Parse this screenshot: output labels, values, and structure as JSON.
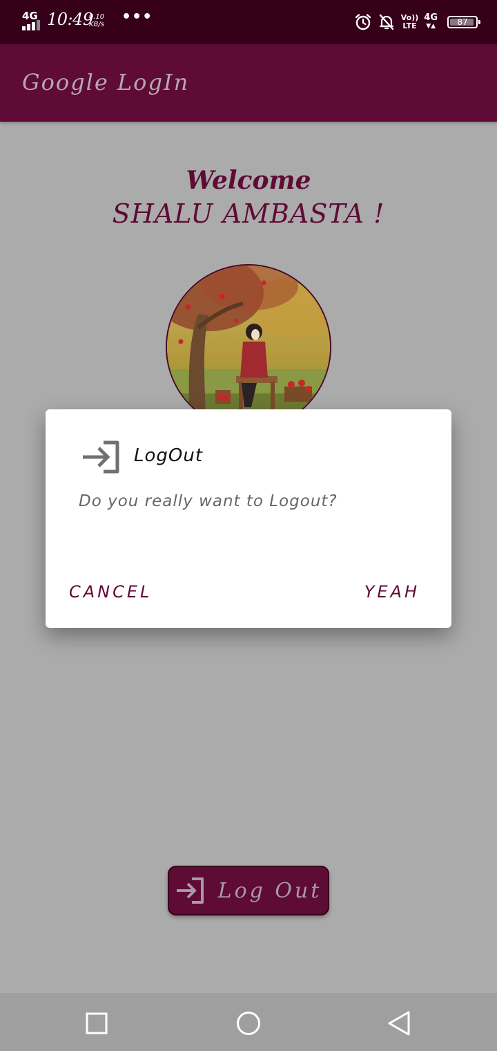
{
  "status_bar": {
    "network": "4G",
    "time": "10:49",
    "speed_value": "0.10",
    "speed_unit": "KB/s",
    "overflow": "•••",
    "volte_top": "Vo))",
    "volte_bottom": "LTE",
    "data_type": "4G",
    "battery": "87",
    "icons": [
      "alarm-icon",
      "mute-notification-icon",
      "volte-icon",
      "signal-4g-icon",
      "battery-icon"
    ]
  },
  "app_bar": {
    "title": "Google LogIn"
  },
  "main": {
    "welcome_line1": "Welcome",
    "welcome_line2": "SHALU AMBASTA !",
    "logout_button_label": "Log Out"
  },
  "dialog": {
    "title": "LogOut",
    "message": "Do you really want to Logout?",
    "cancel_label": "CANCEL",
    "confirm_label": "YEAH",
    "icon": "logout-icon"
  },
  "nav_bar": {
    "icons": [
      "recents-icon",
      "home-icon",
      "back-icon"
    ]
  },
  "colors": {
    "status_bar": "#37001a",
    "app_bar": "#5e0b36",
    "accent": "#5e0b36",
    "scrim_background": "#ababab",
    "dialog_background": "#ffffff"
  }
}
